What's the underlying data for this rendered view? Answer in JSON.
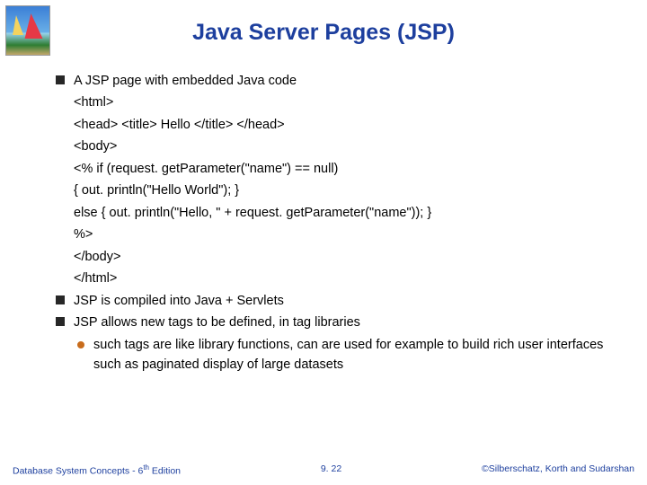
{
  "title": "Java Server Pages (JSP)",
  "bullets": [
    {
      "text": "A JSP page with embedded Java code",
      "code": [
        "<html>",
        "<head> <title> Hello </title> </head>",
        "<body>",
        "<% if (request. getParameter(\"name\") == null)",
        "{ out. println(\"Hello World\"); }",
        "else { out. println(\"Hello, \" + request. getParameter(\"name\")); }",
        "%>",
        "</body>",
        "</html>"
      ]
    },
    {
      "text": "JSP is compiled into Java + Servlets"
    },
    {
      "text": "JSP allows new tags to be defined, in tag libraries",
      "sub": [
        "such tags are like library functions, can are used for example to build rich user interfaces such as paginated display of large datasets"
      ]
    }
  ],
  "footer": {
    "left_a": "Database System Concepts - 6",
    "left_sup": "th",
    "left_b": " Edition",
    "center": "9. 22",
    "right": "©Silberschatz, Korth and Sudarshan"
  }
}
